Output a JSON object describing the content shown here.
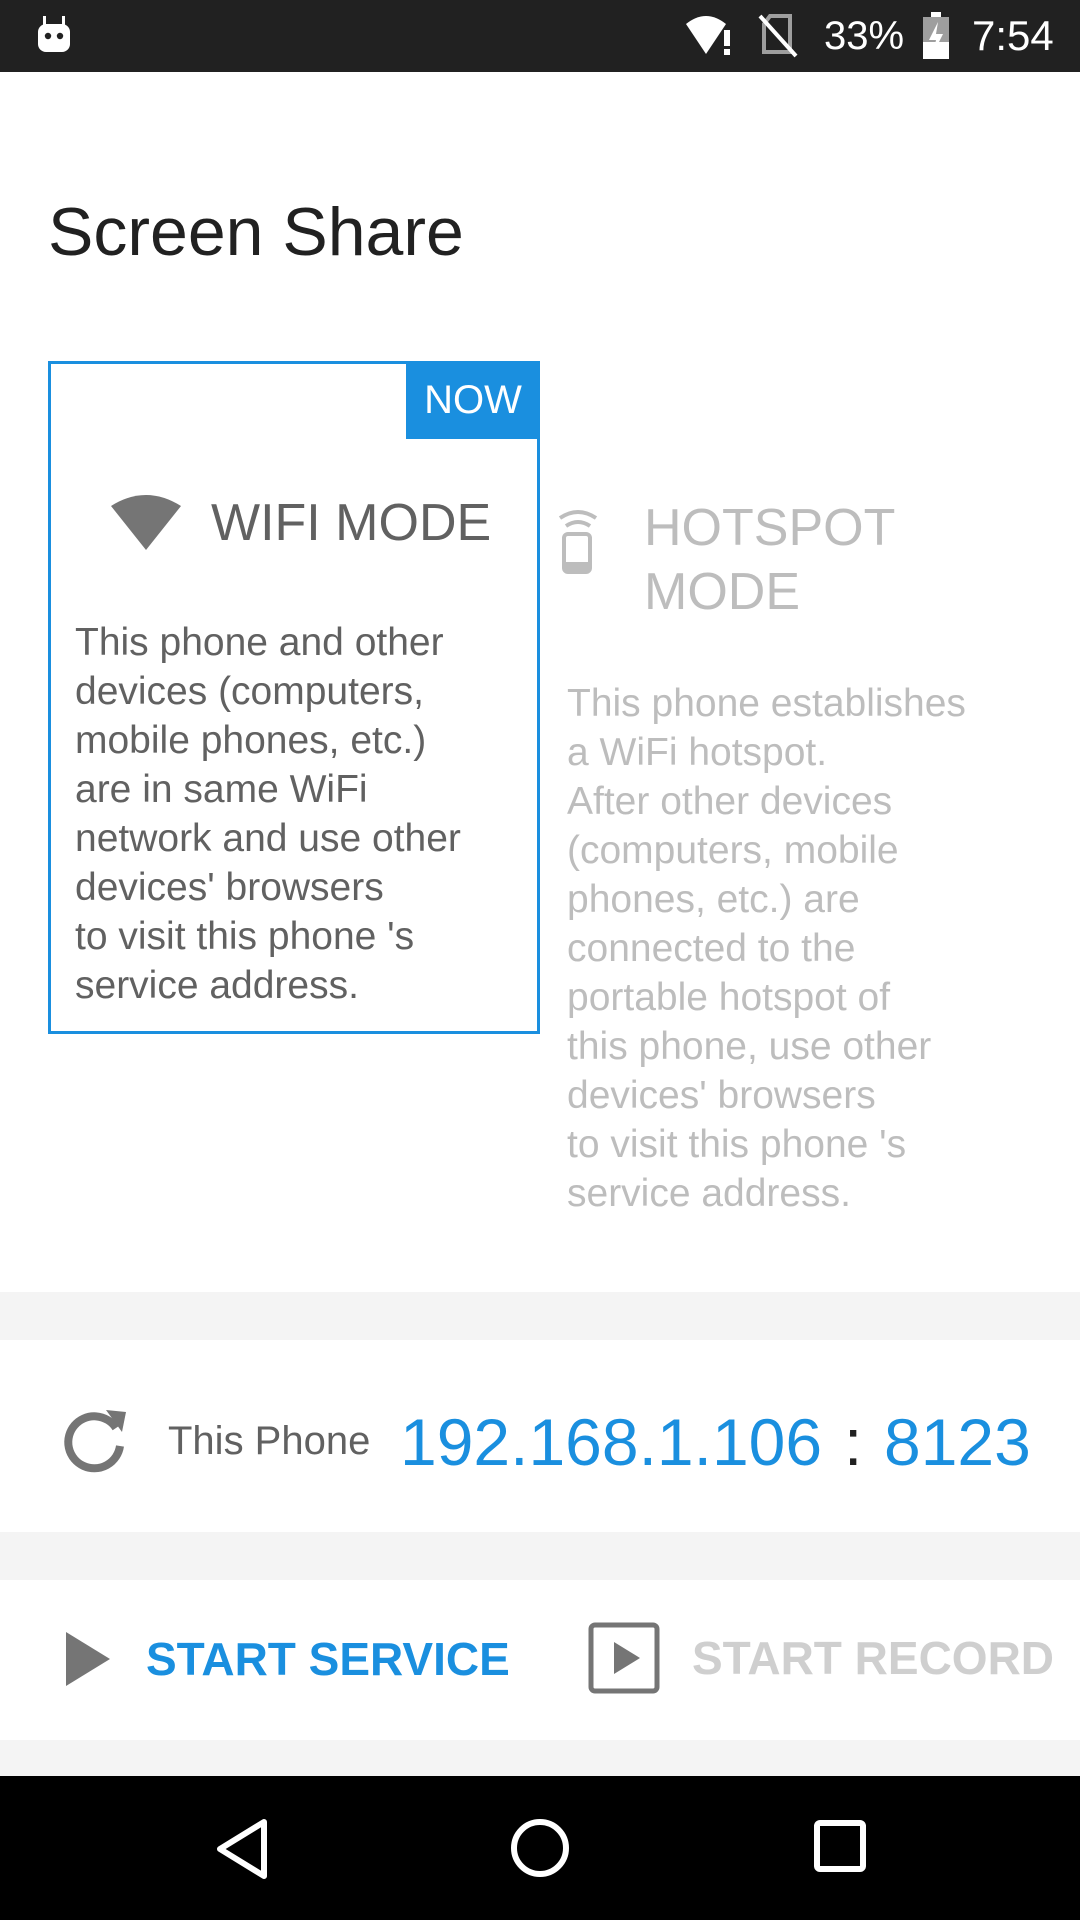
{
  "status_bar": {
    "battery_percent": "33%",
    "time": "7:54",
    "icons": [
      "app-icon",
      "wifi-icon",
      "no-sim-icon",
      "battery-charging-icon"
    ]
  },
  "page": {
    "title": "Screen Share"
  },
  "modes": {
    "wifi": {
      "badge": "NOW",
      "title": "WIFI MODE",
      "description": "This phone and other\ndevices (computers,\nmobile phones, etc.)\nare in same WiFi\nnetwork and use other\ndevices' browsers\nto visit this phone 's\nservice address.",
      "selected": true,
      "icon": "wifi-icon"
    },
    "hotspot": {
      "title": "HOTSPOT\nMODE",
      "description": "This phone establishes\na WiFi hotspot.\nAfter other devices\n(computers, mobile\nphones, etc.) are\nconnected to the\nportable hotspot of\nthis phone, use other\ndevices' browsers\nto visit this phone 's\nservice address.",
      "selected": false,
      "icon": "hotspot-icon"
    }
  },
  "address": {
    "label": "This Phone",
    "ip": "192.168.1.106",
    "separator": ":",
    "port": "8123",
    "icon": "refresh-icon"
  },
  "actions": {
    "start_service": {
      "label": "START SERVICE",
      "icon": "play-icon",
      "enabled": true
    },
    "start_record": {
      "label": "START RECORD",
      "icon": "record-play-icon",
      "enabled": false
    }
  },
  "nav_bar": {
    "icons": [
      "back-icon",
      "home-icon",
      "recents-icon"
    ]
  },
  "colors": {
    "accent": "#1a8fdf",
    "text_primary": "#212121",
    "text_secondary": "#616161",
    "text_disabled": "#bdbdbd",
    "status_bar": "#212121",
    "nav_bar": "#000000",
    "separator": "#f4f4f4"
  }
}
